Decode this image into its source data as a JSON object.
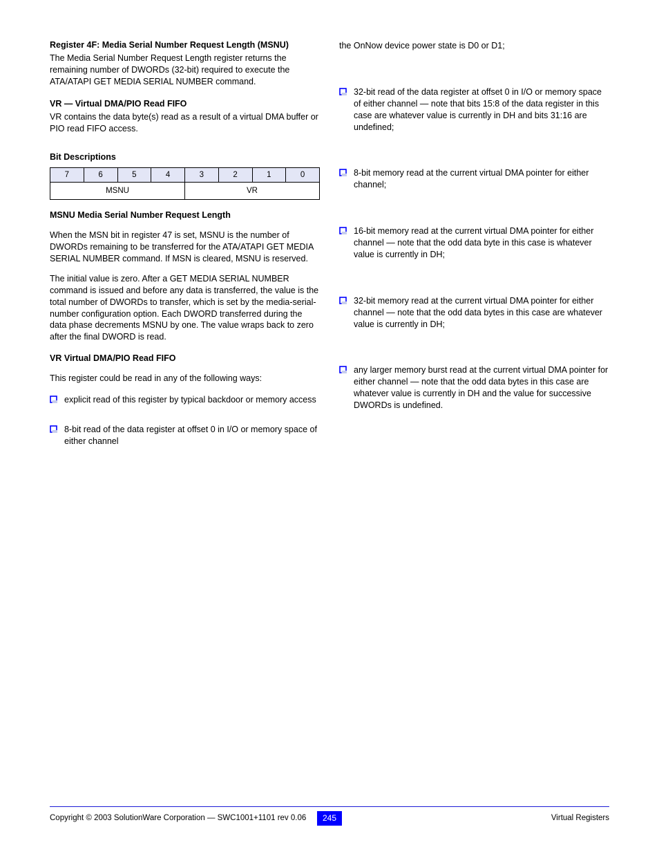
{
  "left": {
    "reg": {
      "label": "Register 4F: Media Serial Number Request Length (MSNU)",
      "desc": "The Media Serial Number Request Length register returns the remaining number of DWORDs (32-bit) required to execute the ATA/ATAPI GET MEDIA SERIAL NUMBER command."
    },
    "vr": {
      "title": "VR — Virtual DMA/PIO Read FIFO",
      "desc": "VR contains the data byte(s) read as a result of a virtual DMA buffer or PIO read FIFO access."
    },
    "bits_title": "Bit Descriptions",
    "table": {
      "heads": [
        "7",
        "6",
        "5",
        "4",
        "3",
        "2",
        "1",
        "0"
      ],
      "row": [
        "MSNU",
        "VR"
      ]
    },
    "msnu_block": {
      "head": "MSNU    Media Serial Number Request Length",
      "p1": "When the MSN bit in register 47 is set, MSNU is the number of DWORDs remaining to be transferred for the ATA/ATAPI GET MEDIA SERIAL NUMBER command. If MSN is cleared, MSNU is reserved.",
      "p2": "The initial value is zero. After a GET MEDIA SERIAL NUMBER command is issued and before any data is transferred, the value is the total number of DWORDs to transfer, which is set by the media-serial-number configuration option. Each DWORD transferred during the data phase decrements MSNU by one. The value wraps back to zero after the final DWORD is read."
    },
    "vr_block": {
      "head": "VR      Virtual DMA/PIO Read FIFO",
      "line": "This register could be read in any of the following ways:",
      "b1": "explicit read of this register by typical backdoor or memory access",
      "b2": "8-bit read of the data register at offset 0 in I/O or memory space of either channel"
    }
  },
  "right": {
    "pre": "the OnNow device power state is D0 or D1;",
    "bullets": [
      "32-bit read of the data register at offset 0 in I/O or memory space of either channel — note that bits 15:8 of the data register in this case are whatever value is currently in DH and bits 31:16 are undefined;",
      "8-bit memory read at the current virtual DMA pointer for either channel;",
      "16-bit memory read at the current virtual DMA pointer for either channel — note that the odd data byte in this case is whatever value is currently in DH;",
      "32-bit memory read at the current virtual DMA pointer for either channel — note that the odd data bytes in this case are whatever value is currently in DH;",
      "any larger memory burst read at the current virtual DMA pointer for either channel — note that the odd data bytes in this case are whatever value is currently in DH and the value for successive DWORDs is undefined."
    ]
  },
  "footer": {
    "left": "Copyright © 2003 SolutionWare Corporation — SWC1001+1101 rev 0.06",
    "right": "Virtual Registers",
    "page": "245"
  }
}
